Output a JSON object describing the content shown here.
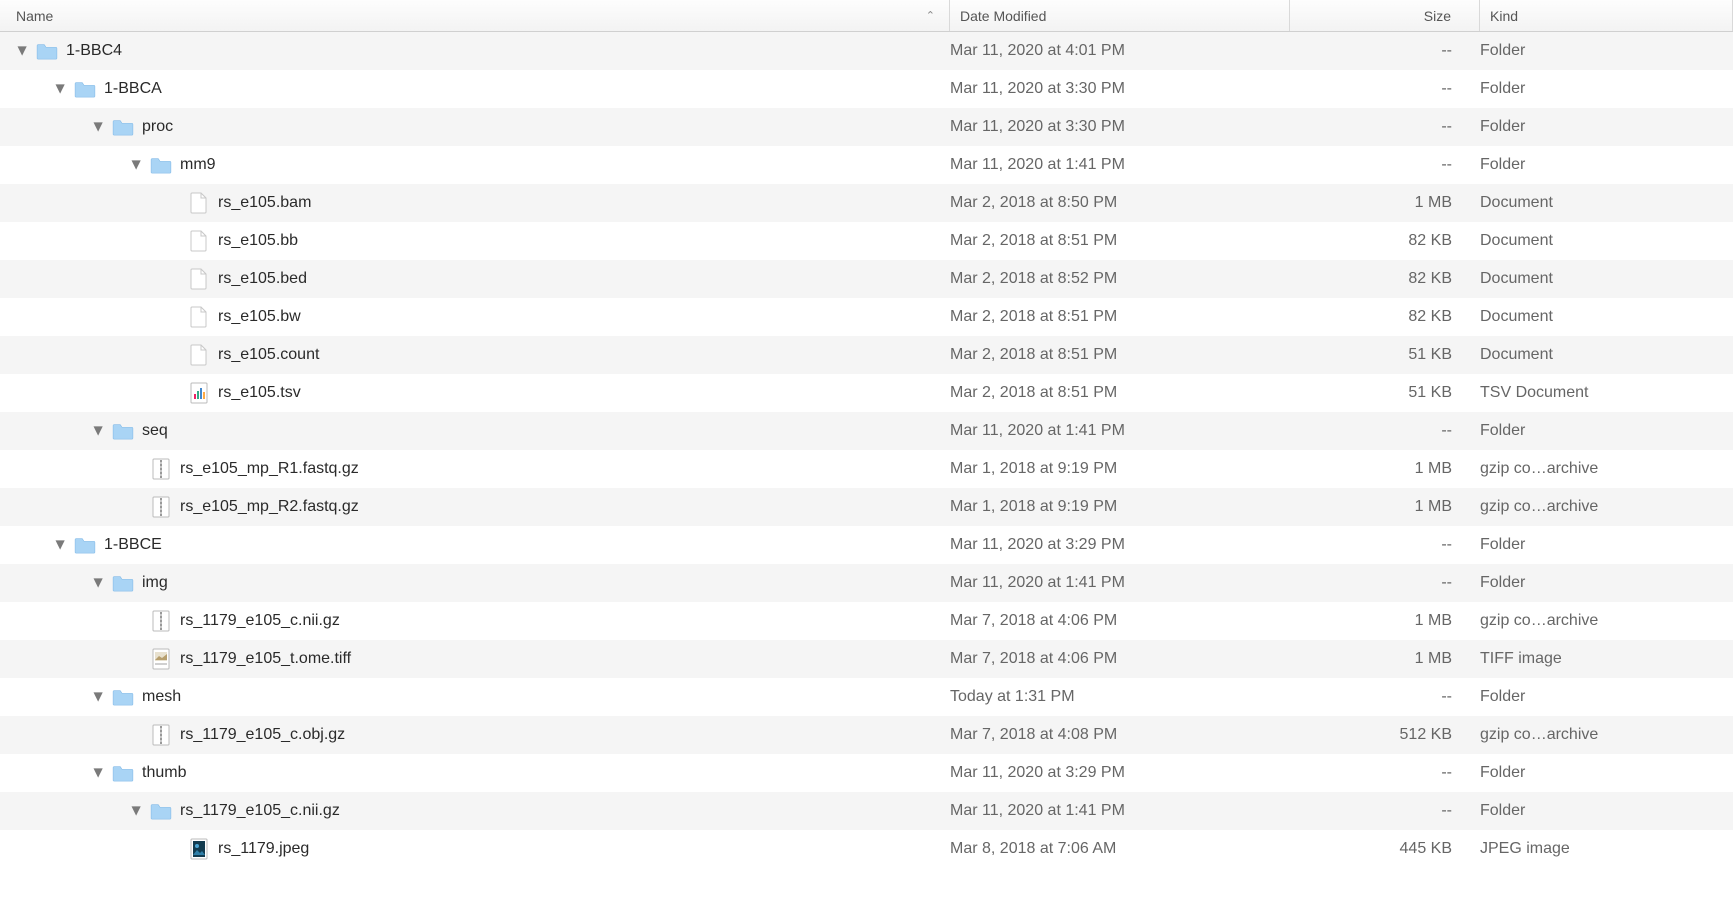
{
  "columns": {
    "name": "Name",
    "date": "Date Modified",
    "size": "Size",
    "kind": "Kind",
    "sort_glyph": "⌃"
  },
  "rows": [
    {
      "depth": 0,
      "expanded": true,
      "icon": "folder",
      "name": "1-BBC4",
      "date": "Mar 11, 2020 at 4:01 PM",
      "size": "--",
      "kind": "Folder"
    },
    {
      "depth": 1,
      "expanded": true,
      "icon": "folder",
      "name": "1-BBCA",
      "date": "Mar 11, 2020 at 3:30 PM",
      "size": "--",
      "kind": "Folder"
    },
    {
      "depth": 2,
      "expanded": true,
      "icon": "folder",
      "name": "proc",
      "date": "Mar 11, 2020 at 3:30 PM",
      "size": "--",
      "kind": "Folder"
    },
    {
      "depth": 3,
      "expanded": true,
      "icon": "folder",
      "name": "mm9",
      "date": "Mar 11, 2020 at 1:41 PM",
      "size": "--",
      "kind": "Folder"
    },
    {
      "depth": 4,
      "expanded": null,
      "icon": "doc",
      "name": "rs_e105.bam",
      "date": "Mar 2, 2018 at 8:50 PM",
      "size": "1 MB",
      "kind": "Document"
    },
    {
      "depth": 4,
      "expanded": null,
      "icon": "doc",
      "name": "rs_e105.bb",
      "date": "Mar 2, 2018 at 8:51 PM",
      "size": "82 KB",
      "kind": "Document"
    },
    {
      "depth": 4,
      "expanded": null,
      "icon": "doc",
      "name": "rs_e105.bed",
      "date": "Mar 2, 2018 at 8:52 PM",
      "size": "82 KB",
      "kind": "Document"
    },
    {
      "depth": 4,
      "expanded": null,
      "icon": "doc",
      "name": "rs_e105.bw",
      "date": "Mar 2, 2018 at 8:51 PM",
      "size": "82 KB",
      "kind": "Document"
    },
    {
      "depth": 4,
      "expanded": null,
      "icon": "doc",
      "name": "rs_e105.count",
      "date": "Mar 2, 2018 at 8:51 PM",
      "size": "51 KB",
      "kind": "Document"
    },
    {
      "depth": 4,
      "expanded": null,
      "icon": "tsv",
      "name": "rs_e105.tsv",
      "date": "Mar 2, 2018 at 8:51 PM",
      "size": "51 KB",
      "kind": "TSV Document"
    },
    {
      "depth": 2,
      "expanded": true,
      "icon": "folder",
      "name": "seq",
      "date": "Mar 11, 2020 at 1:41 PM",
      "size": "--",
      "kind": "Folder"
    },
    {
      "depth": 3,
      "expanded": null,
      "icon": "gz",
      "name": "rs_e105_mp_R1.fastq.gz",
      "date": "Mar 1, 2018 at 9:19 PM",
      "size": "1 MB",
      "kind": "gzip co…archive"
    },
    {
      "depth": 3,
      "expanded": null,
      "icon": "gz",
      "name": "rs_e105_mp_R2.fastq.gz",
      "date": "Mar 1, 2018 at 9:19 PM",
      "size": "1 MB",
      "kind": "gzip co…archive"
    },
    {
      "depth": 1,
      "expanded": true,
      "icon": "folder",
      "name": "1-BBCE",
      "date": "Mar 11, 2020 at 3:29 PM",
      "size": "--",
      "kind": "Folder"
    },
    {
      "depth": 2,
      "expanded": true,
      "icon": "folder",
      "name": "img",
      "date": "Mar 11, 2020 at 1:41 PM",
      "size": "--",
      "kind": "Folder"
    },
    {
      "depth": 3,
      "expanded": null,
      "icon": "gz",
      "name": "rs_1179_e105_c.nii.gz",
      "date": "Mar 7, 2018 at 4:06 PM",
      "size": "1 MB",
      "kind": "gzip co…archive"
    },
    {
      "depth": 3,
      "expanded": null,
      "icon": "tiff",
      "name": "rs_1179_e105_t.ome.tiff",
      "date": "Mar 7, 2018 at 4:06 PM",
      "size": "1 MB",
      "kind": "TIFF image"
    },
    {
      "depth": 2,
      "expanded": true,
      "icon": "folder",
      "name": "mesh",
      "date": "Today at 1:31 PM",
      "size": "--",
      "kind": "Folder"
    },
    {
      "depth": 3,
      "expanded": null,
      "icon": "gz",
      "name": "rs_1179_e105_c.obj.gz",
      "date": "Mar 7, 2018 at 4:08 PM",
      "size": "512 KB",
      "kind": "gzip co…archive"
    },
    {
      "depth": 2,
      "expanded": true,
      "icon": "folder",
      "name": "thumb",
      "date": "Mar 11, 2020 at 3:29 PM",
      "size": "--",
      "kind": "Folder"
    },
    {
      "depth": 3,
      "expanded": true,
      "icon": "folder",
      "name": "rs_1179_e105_c.nii.gz",
      "date": "Mar 11, 2020 at 1:41 PM",
      "size": "--",
      "kind": "Folder"
    },
    {
      "depth": 4,
      "expanded": null,
      "icon": "jpeg",
      "name": "rs_1179.jpeg",
      "date": "Mar 8, 2018 at 7:06 AM",
      "size": "445 KB",
      "kind": "JPEG image"
    }
  ]
}
